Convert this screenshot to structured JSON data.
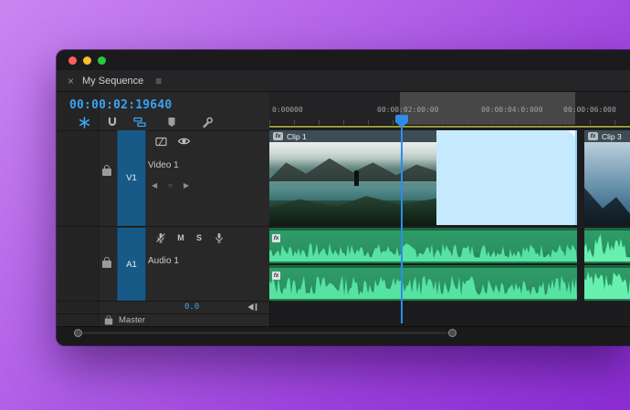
{
  "window": {
    "tab": {
      "close": "×",
      "title": "My Sequence",
      "menu": "≡"
    },
    "timecode": "00:00:02:19640",
    "traffic_lights": [
      "close",
      "minimize",
      "zoom"
    ]
  },
  "toolbar": {
    "icons": [
      {
        "name": "insert-nest",
        "active": true
      },
      {
        "name": "snap",
        "active": false
      },
      {
        "name": "linked-selection",
        "active": true
      },
      {
        "name": "add-marker",
        "active": false
      },
      {
        "name": "timeline-display-settings",
        "active": false
      }
    ]
  },
  "ruler": {
    "labels": [
      "0:00000",
      "00:00:02:00:00",
      "00:00:04:0:000",
      "00:00:06:000"
    ]
  },
  "tracks": {
    "video": {
      "badge": "V1",
      "name": "Video 1",
      "keyframe_prev": "◀",
      "keyframe_dot": "○",
      "keyframe_next": "▶"
    },
    "audio": {
      "badge": "A1",
      "name": "Audio 1",
      "mute": "M",
      "solo": "S",
      "level": "0.0"
    },
    "master": {
      "name": "Master"
    }
  },
  "clips": {
    "fx_badge": "fx",
    "video": [
      {
        "label": "Clip 1"
      },
      {
        "label": "Clip 3"
      }
    ]
  },
  "colors": {
    "accent_blue": "#3aa3f2",
    "playhead": "#2f8ceb",
    "selection_fill": "#c6eafd",
    "track_button_blue": "#175a88",
    "audio_clip_green": "#2b9462",
    "waveform_green": "#56e2a2",
    "work_bar_yellow": "#9a9a3c",
    "desktop_purple_start": "#cb85f1",
    "desktop_purple_end": "#8c2dd5"
  }
}
